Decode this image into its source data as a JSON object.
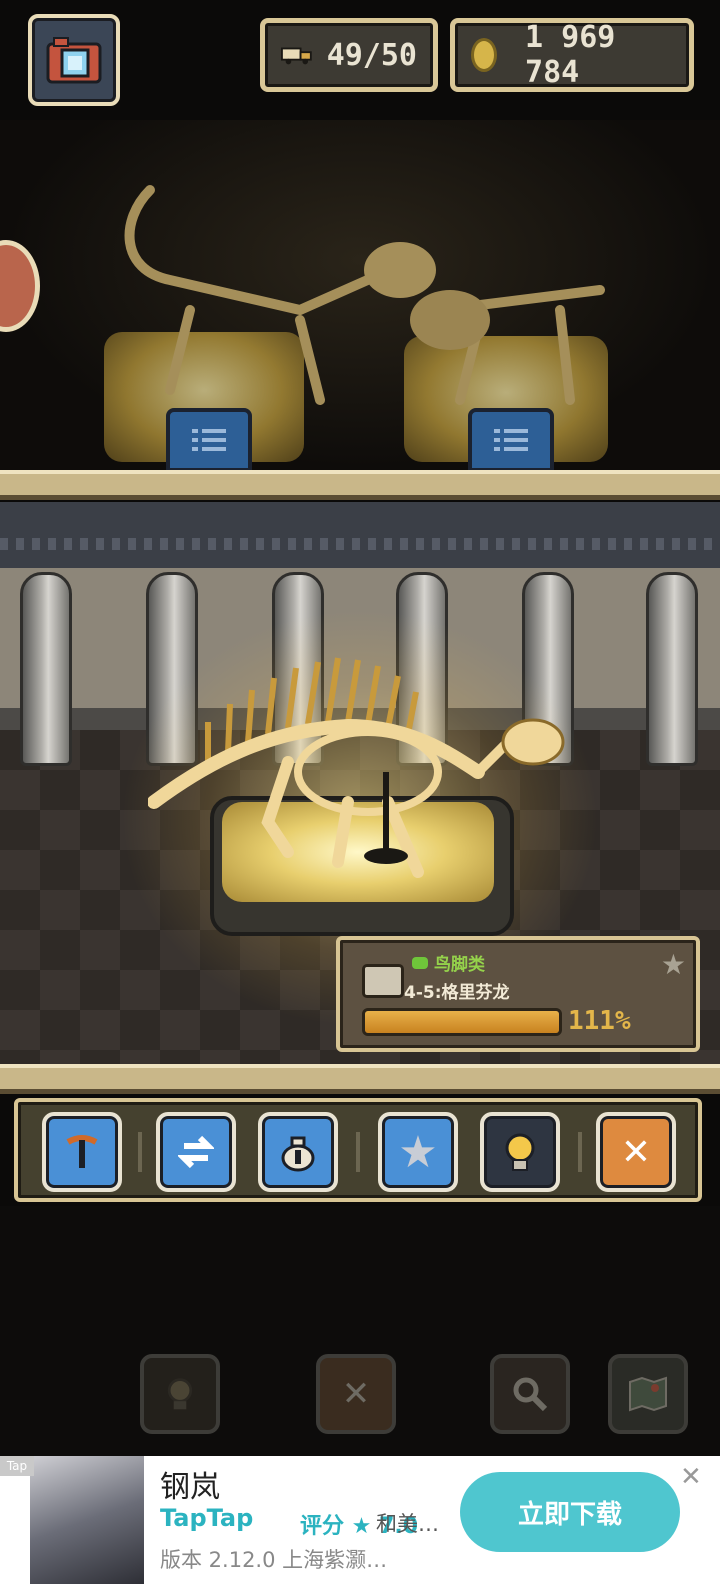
{
  "hud": {
    "capacity": "49/50",
    "coins": "1 969 784"
  },
  "fossil_card": {
    "category": "鸟脚类",
    "name": "4-5:格里芬龙",
    "completion_text": "111%",
    "completion_value": 1.0
  },
  "toolbar": {
    "close_glyph": "✕"
  },
  "dim_controls": {
    "close_glyph": "✕"
  },
  "ad": {
    "tag": "Tap",
    "title": "钢岚",
    "platform": "TapTap",
    "rating": "评分 ★ 7.0",
    "developer": "和美…",
    "version": "版本 2.12.0  上海紫灏…",
    "download_label": "立即下载",
    "close_glyph": "✕"
  },
  "colors": {
    "button_blue": "#4a90d6",
    "button_orange": "#de8a3f",
    "frame_gold": "#d8c594",
    "category_green": "#95d24b",
    "ad_accent": "#4fc6cf"
  }
}
